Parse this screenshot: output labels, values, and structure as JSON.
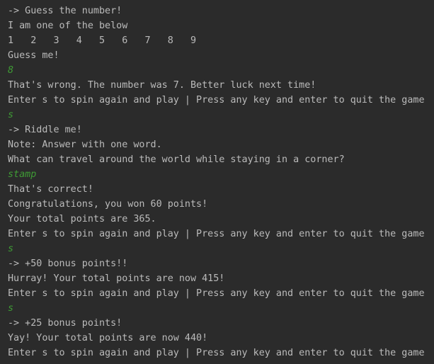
{
  "console": {
    "lines": [
      {
        "text": "-> Guess the number!",
        "kind": "output"
      },
      {
        "text": "I am one of the below",
        "kind": "output"
      },
      {
        "text": "1   2   3   4   5   6   7   8   9",
        "kind": "output"
      },
      {
        "text": "Guess me!",
        "kind": "output"
      },
      {
        "text": "8",
        "kind": "input"
      },
      {
        "text": "That's wrong. The number was 7. Better luck next time!",
        "kind": "output"
      },
      {
        "text": "Enter s to spin again and play | Press any key and enter to quit the game",
        "kind": "output"
      },
      {
        "text": "s",
        "kind": "input"
      },
      {
        "text": "-> Riddle me!",
        "kind": "output"
      },
      {
        "text": "Note: Answer with one word.",
        "kind": "output"
      },
      {
        "text": "What can travel around the world while staying in a corner?",
        "kind": "output"
      },
      {
        "text": "stamp",
        "kind": "input"
      },
      {
        "text": "That's correct!",
        "kind": "output"
      },
      {
        "text": "Congratulations, you won 60 points!",
        "kind": "output"
      },
      {
        "text": "Your total points are 365.",
        "kind": "output"
      },
      {
        "text": "Enter s to spin again and play | Press any key and enter to quit the game",
        "kind": "output"
      },
      {
        "text": "s",
        "kind": "input"
      },
      {
        "text": "-> +50 bonus points!!",
        "kind": "output"
      },
      {
        "text": "Hurray! Your total points are now 415!",
        "kind": "output"
      },
      {
        "text": "Enter s to spin again and play | Press any key and enter to quit the game",
        "kind": "output"
      },
      {
        "text": "s",
        "kind": "input"
      },
      {
        "text": "-> +25 bonus points!",
        "kind": "output"
      },
      {
        "text": "Yay! Your total points are now 440!",
        "kind": "output"
      },
      {
        "text": "Enter s to spin again and play | Press any key and enter to quit the game",
        "kind": "output"
      }
    ]
  },
  "colors": {
    "background": "#2b2b2b",
    "output_text": "#bbbbbb",
    "user_input_text": "#3f9c35"
  }
}
